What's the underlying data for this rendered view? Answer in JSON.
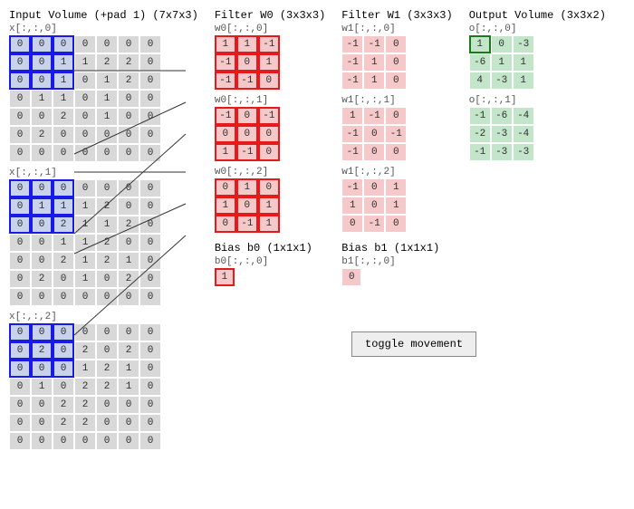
{
  "titles": {
    "input": "Input Volume (+pad 1) (7x7x3)",
    "w0": "Filter W0 (3x3x3)",
    "w1": "Filter W1 (3x3x3)",
    "out": "Output Volume (3x3x2)",
    "b0": "Bias b0 (1x1x1)",
    "b1": "Bias b1 (1x1x1)"
  },
  "labels": {
    "x0": "x[:,:,0]",
    "x1": "x[:,:,1]",
    "x2": "x[:,:,2]",
    "w00": "w0[:,:,0]",
    "w01": "w0[:,:,1]",
    "w02": "w0[:,:,2]",
    "w10": "w1[:,:,0]",
    "w11": "w1[:,:,1]",
    "w12": "w1[:,:,2]",
    "o0": "o[:,:,0]",
    "o1": "o[:,:,1]",
    "b00": "b0[:,:,0]",
    "b10": "b1[:,:,0]"
  },
  "toggle_label": "toggle movement",
  "input": {
    "slice0": [
      [
        0,
        0,
        0,
        0,
        0,
        0,
        0
      ],
      [
        0,
        0,
        1,
        1,
        2,
        2,
        0
      ],
      [
        0,
        0,
        1,
        0,
        1,
        2,
        0
      ],
      [
        0,
        1,
        1,
        0,
        1,
        0,
        0
      ],
      [
        0,
        0,
        2,
        0,
        1,
        0,
        0
      ],
      [
        0,
        2,
        0,
        0,
        0,
        0,
        0
      ],
      [
        0,
        0,
        0,
        0,
        0,
        0,
        0
      ]
    ],
    "slice1": [
      [
        0,
        0,
        0,
        0,
        0,
        0,
        0
      ],
      [
        0,
        1,
        1,
        1,
        2,
        0,
        0
      ],
      [
        0,
        0,
        2,
        1,
        1,
        2,
        0
      ],
      [
        0,
        0,
        1,
        1,
        2,
        0,
        0
      ],
      [
        0,
        0,
        2,
        1,
        2,
        1,
        0
      ],
      [
        0,
        2,
        0,
        1,
        0,
        2,
        0
      ],
      [
        0,
        0,
        0,
        0,
        0,
        0,
        0
      ]
    ],
    "slice2": [
      [
        0,
        0,
        0,
        0,
        0,
        0,
        0
      ],
      [
        0,
        2,
        0,
        2,
        0,
        2,
        0
      ],
      [
        0,
        0,
        0,
        1,
        2,
        1,
        0
      ],
      [
        0,
        1,
        0,
        2,
        2,
        1,
        0
      ],
      [
        0,
        0,
        2,
        2,
        0,
        0,
        0
      ],
      [
        0,
        0,
        2,
        2,
        0,
        0,
        0
      ],
      [
        0,
        0,
        0,
        0,
        0,
        0,
        0
      ]
    ]
  },
  "w0": {
    "s0": [
      [
        1,
        1,
        -1
      ],
      [
        -1,
        0,
        1
      ],
      [
        -1,
        -1,
        0
      ]
    ],
    "s1": [
      [
        -1,
        0,
        -1
      ],
      [
        0,
        0,
        0
      ],
      [
        1,
        -1,
        0
      ]
    ],
    "s2": [
      [
        0,
        1,
        0
      ],
      [
        1,
        0,
        1
      ],
      [
        0,
        -1,
        1
      ]
    ]
  },
  "w1": {
    "s0": [
      [
        -1,
        -1,
        0
      ],
      [
        -1,
        1,
        0
      ],
      [
        -1,
        1,
        0
      ]
    ],
    "s1": [
      [
        1,
        -1,
        0
      ],
      [
        -1,
        0,
        -1
      ],
      [
        -1,
        0,
        0
      ]
    ],
    "s2": [
      [
        -1,
        0,
        1
      ],
      [
        1,
        0,
        1
      ],
      [
        0,
        -1,
        0
      ]
    ]
  },
  "out": {
    "s0": [
      [
        1,
        0,
        -3
      ],
      [
        -6,
        1,
        1
      ],
      [
        4,
        -3,
        1
      ]
    ],
    "s1": [
      [
        -1,
        -6,
        -4
      ],
      [
        -2,
        -3,
        -4
      ],
      [
        -1,
        -3,
        -3
      ]
    ]
  },
  "bias": {
    "b0": 1,
    "b1": 0
  },
  "highlight": {
    "input_window": {
      "r": 0,
      "c": 0,
      "size": 3
    },
    "out_cell": {
      "r": 0,
      "c": 0
    }
  },
  "colors": {
    "blue": "#1a1ae6",
    "red": "#e61a1a",
    "green": "#1a7a1a",
    "input_bg": "#d8d8d8",
    "input_hl": "#c8d2ea",
    "filter_bg": "#f5c9c9",
    "out_bg": "#c3e6cb"
  },
  "chart_data": {
    "type": "table",
    "description": "Convolution demo: 7x7x3 padded input, two 3x3x3 filters W0/W1 with biases b0/b1, producing 3x3x2 output. Blue box = current 3x3 receptive field (top-left), red boxes = filter weights, green box = current output cell o[0,0,0].",
    "input_shape": [
      7,
      7,
      3
    ],
    "filter_shape": [
      3,
      3,
      3
    ],
    "num_filters": 2,
    "output_shape": [
      3,
      3,
      2
    ],
    "stride": 2,
    "input": {
      "slice0": [
        [
          0,
          0,
          0,
          0,
          0,
          0,
          0
        ],
        [
          0,
          0,
          1,
          1,
          2,
          2,
          0
        ],
        [
          0,
          0,
          1,
          0,
          1,
          2,
          0
        ],
        [
          0,
          1,
          1,
          0,
          1,
          0,
          0
        ],
        [
          0,
          0,
          2,
          0,
          1,
          0,
          0
        ],
        [
          0,
          2,
          0,
          0,
          0,
          0,
          0
        ],
        [
          0,
          0,
          0,
          0,
          0,
          0,
          0
        ]
      ],
      "slice1": [
        [
          0,
          0,
          0,
          0,
          0,
          0,
          0
        ],
        [
          0,
          1,
          1,
          1,
          2,
          0,
          0
        ],
        [
          0,
          0,
          2,
          1,
          1,
          2,
          0
        ],
        [
          0,
          0,
          1,
          1,
          2,
          0,
          0
        ],
        [
          0,
          0,
          2,
          1,
          2,
          1,
          0
        ],
        [
          0,
          2,
          0,
          1,
          0,
          2,
          0
        ],
        [
          0,
          0,
          0,
          0,
          0,
          0,
          0
        ]
      ],
      "slice2": [
        [
          0,
          0,
          0,
          0,
          0,
          0,
          0
        ],
        [
          0,
          2,
          0,
          2,
          0,
          2,
          0
        ],
        [
          0,
          0,
          0,
          1,
          2,
          1,
          0
        ],
        [
          0,
          1,
          0,
          2,
          2,
          1,
          0
        ],
        [
          0,
          0,
          2,
          2,
          0,
          0,
          0
        ],
        [
          0,
          0,
          2,
          2,
          0,
          0,
          0
        ],
        [
          0,
          0,
          0,
          0,
          0,
          0,
          0
        ]
      ]
    },
    "W0": {
      "s0": [
        [
          1,
          1,
          -1
        ],
        [
          -1,
          0,
          1
        ],
        [
          -1,
          -1,
          0
        ]
      ],
      "s1": [
        [
          -1,
          0,
          -1
        ],
        [
          0,
          0,
          0
        ],
        [
          1,
          -1,
          0
        ]
      ],
      "s2": [
        [
          0,
          1,
          0
        ],
        [
          1,
          0,
          1
        ],
        [
          0,
          -1,
          1
        ]
      ]
    },
    "W1": {
      "s0": [
        [
          -1,
          -1,
          0
        ],
        [
          -1,
          1,
          0
        ],
        [
          -1,
          1,
          0
        ]
      ],
      "s1": [
        [
          1,
          -1,
          0
        ],
        [
          -1,
          0,
          -1
        ],
        [
          -1,
          0,
          0
        ]
      ],
      "s2": [
        [
          -1,
          0,
          1
        ],
        [
          1,
          0,
          1
        ],
        [
          0,
          -1,
          0
        ]
      ]
    },
    "b0": 1,
    "b1": 0,
    "output": {
      "s0": [
        [
          1,
          0,
          -3
        ],
        [
          -6,
          1,
          1
        ],
        [
          4,
          -3,
          1
        ]
      ],
      "s1": [
        [
          -1,
          -6,
          -4
        ],
        [
          -2,
          -3,
          -4
        ],
        [
          -1,
          -3,
          -3
        ]
      ]
    }
  }
}
